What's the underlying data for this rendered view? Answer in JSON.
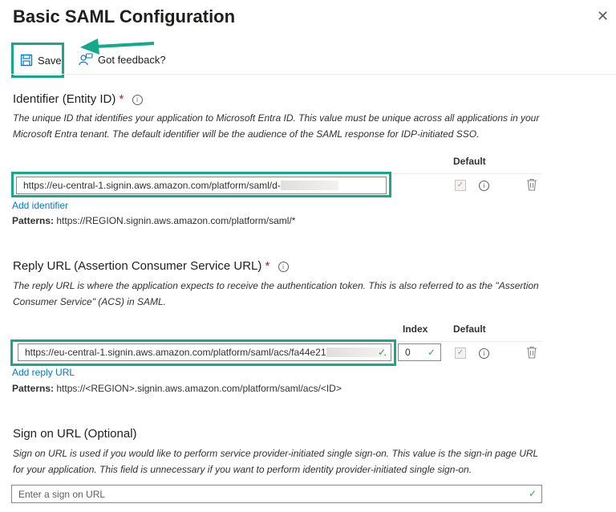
{
  "header": {
    "title": "Basic SAML Configuration",
    "close_glyph": "✕"
  },
  "toolbar": {
    "save_label": "Save",
    "feedback_label": "Got feedback?"
  },
  "identifier": {
    "title": "Identifier (Entity ID)",
    "required_mark": "*",
    "description": "The unique ID that identifies your application to Microsoft Entra ID. This value must be unique across all applications in your Microsoft Entra tenant. The default identifier will be the audience of the SAML response for IDP-initiated SSO.",
    "default_header": "Default",
    "value": "https://eu-central-1.signin.aws.amazon.com/platform/saml/d-",
    "add_link": "Add identifier",
    "patterns_label": "Patterns:",
    "patterns_value": "https://REGION.signin.aws.amazon.com/platform/saml/*"
  },
  "reply": {
    "title": "Reply URL (Assertion Consumer Service URL)",
    "required_mark": "*",
    "description": "The reply URL is where the application expects to receive the authentication token. This is also referred to as the \"Assertion Consumer Service\" (ACS) in SAML.",
    "index_header": "Index",
    "default_header": "Default",
    "value": "https://eu-central-1.signin.aws.amazon.com/platform/saml/acs/fa44e21",
    "index_value": "0",
    "add_link": "Add reply URL",
    "patterns_label": "Patterns:",
    "patterns_value": "https://<REGION>.signin.aws.amazon.com/platform/saml/acs/<ID>"
  },
  "signon": {
    "title": "Sign on URL (Optional)",
    "description": "Sign on URL is used if you would like to perform service provider-initiated single sign-on. This value is the sign-in page URL for your application. This field is unnecessary if you want to perform identity provider-initiated single sign-on.",
    "placeholder": "Enter a sign on URL"
  },
  "colors": {
    "accent": "#15a889",
    "link": "#0078d4",
    "required": "#a4262c",
    "check": "#31a24c"
  }
}
